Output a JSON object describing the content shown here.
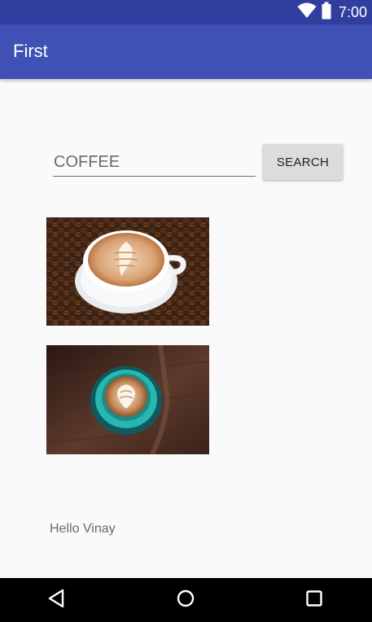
{
  "status_bar": {
    "time": "7:00",
    "icons": [
      "wifi-icon",
      "battery-icon"
    ]
  },
  "app_bar": {
    "title": "First"
  },
  "search": {
    "value": "COFFEE",
    "button_label": "SEARCH"
  },
  "results": [
    {
      "subject": "cappuccino-latte-art-on-coffee-beans"
    },
    {
      "subject": "latte-art-teal-cup-top-view"
    }
  ],
  "greeting": "Hello Vinay",
  "nav_bar": {
    "buttons": [
      "back-icon",
      "home-icon",
      "recents-icon"
    ]
  },
  "colors": {
    "status_bar": "#303f9f",
    "app_bar": "#3f51b5",
    "background": "#fafafa",
    "button": "#dcdcdc"
  }
}
